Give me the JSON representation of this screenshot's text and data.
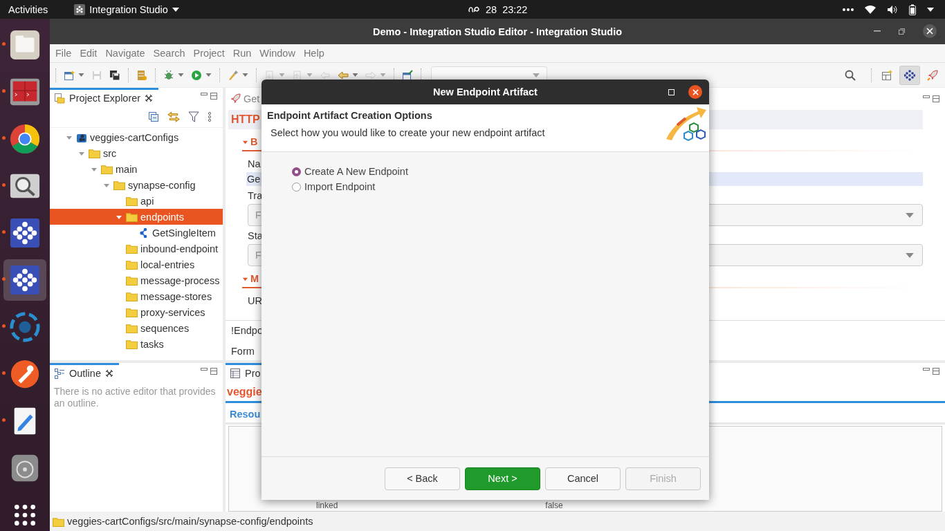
{
  "top_bar": {
    "activities": "Activities",
    "app_menu": "Integration Studio",
    "date": "28",
    "time": "23:22"
  },
  "dock": [
    {
      "kind": "files",
      "running": true,
      "active": false
    },
    {
      "kind": "terminal",
      "running": true,
      "active": false
    },
    {
      "kind": "browser",
      "running": true,
      "active": false
    },
    {
      "kind": "magnifier",
      "running": true,
      "active": false
    },
    {
      "kind": "integration",
      "running": true,
      "active": false
    },
    {
      "kind": "integration",
      "running": true,
      "active": true
    },
    {
      "kind": "swirl",
      "running": true,
      "active": false
    },
    {
      "kind": "pen-circle",
      "running": true,
      "active": false
    },
    {
      "kind": "text-editor",
      "running": true,
      "active": false
    },
    {
      "kind": "disc",
      "running": false,
      "active": false
    },
    {
      "kind": "app-grid",
      "running": false,
      "active": false
    }
  ],
  "window": {
    "title": "Demo - Integration Studio Editor - Integration Studio"
  },
  "menu": [
    "File",
    "Edit",
    "Navigate",
    "Search",
    "Project",
    "Run",
    "Window",
    "Help"
  ],
  "toolbar": {
    "groups": [
      [
        {
          "kind": "new",
          "caret": true,
          "disabled": false
        },
        {
          "kind": "save",
          "caret": false,
          "disabled": true
        },
        {
          "kind": "save-all",
          "caret": false,
          "disabled": false
        }
      ],
      [
        {
          "kind": "server",
          "caret": false,
          "disabled": false
        }
      ],
      [
        {
          "kind": "debug",
          "caret": true,
          "disabled": false
        },
        {
          "kind": "run",
          "caret": true,
          "disabled": false
        }
      ],
      [
        {
          "kind": "pen",
          "caret": true,
          "disabled": false
        }
      ],
      [
        {
          "kind": "next-annotation",
          "caret": true,
          "disabled": true
        },
        {
          "kind": "prev-annotation",
          "caret": true,
          "disabled": true
        },
        {
          "kind": "last-edit",
          "caret": false,
          "disabled": true
        },
        {
          "kind": "back",
          "caret": true,
          "disabled": false
        },
        {
          "kind": "forward",
          "caret": true,
          "disabled": true
        }
      ],
      [
        {
          "kind": "open-task",
          "caret": false,
          "disabled": false
        }
      ]
    ]
  },
  "perspectives": [
    {
      "kind": "open",
      "selected": false
    },
    {
      "kind": "integration",
      "selected": true
    },
    {
      "kind": "rocket",
      "selected": false
    }
  ],
  "project_explorer": {
    "title": "Project Explorer",
    "tree": [
      {
        "label": "veggies-cartConfigs",
        "kind": "project",
        "expanded": true,
        "selected": false,
        "children": [
          {
            "label": "src",
            "kind": "folder",
            "expanded": true,
            "selected": false,
            "children": [
              {
                "label": "main",
                "kind": "folder",
                "expanded": true,
                "selected": false,
                "children": [
                  {
                    "label": "synapse-config",
                    "kind": "folder",
                    "expanded": true,
                    "selected": false,
                    "children": [
                      {
                        "label": "api",
                        "kind": "folder",
                        "selected": false
                      },
                      {
                        "label": "endpoints",
                        "kind": "folder",
                        "expanded": true,
                        "selected": true,
                        "children": [
                          {
                            "label": "GetSingleItem",
                            "kind": "endpoint",
                            "selected": false
                          }
                        ]
                      },
                      {
                        "label": "inbound-endpoint",
                        "kind": "folder",
                        "selected": false
                      },
                      {
                        "label": "local-entries",
                        "kind": "folder",
                        "selected": false
                      },
                      {
                        "label": "message-process",
                        "kind": "folder",
                        "selected": false
                      },
                      {
                        "label": "message-stores",
                        "kind": "folder",
                        "selected": false
                      },
                      {
                        "label": "proxy-services",
                        "kind": "folder",
                        "selected": false
                      },
                      {
                        "label": "sequences",
                        "kind": "folder",
                        "selected": false
                      },
                      {
                        "label": "tasks",
                        "kind": "folder",
                        "selected": false
                      }
                    ]
                  }
                ]
              }
            ]
          }
        ]
      }
    ]
  },
  "outline": {
    "title": "Outline",
    "message": "There is no active editor that provides an outline."
  },
  "editor": {
    "tab": "Get",
    "form_title": "HTTP",
    "sections": [
      {
        "label": "B",
        "expanded": true,
        "fields": [
          {
            "kind": "text",
            "label": "Na",
            "value": "Ge"
          },
          {
            "kind": "select",
            "label": "Tra",
            "value": "F"
          },
          {
            "kind": "select",
            "label": "Sta",
            "value": "F"
          }
        ]
      },
      {
        "label": "M",
        "expanded": true,
        "fields": [
          {
            "kind": "none",
            "label": "UR"
          }
        ]
      }
    ],
    "bottom_tabs": [
      "!Endpo",
      "Form"
    ]
  },
  "properties": {
    "tab": "Pro",
    "title": "veggie",
    "tabs": [
      "Resou"
    ],
    "rows": [
      {
        "property": "linked",
        "value": "false"
      }
    ]
  },
  "dialog": {
    "title": "New Endpoint Artifact",
    "heading": "Endpoint Artifact Creation Options",
    "description": "Select how you would like to create your new endpoint artifact",
    "options": [
      {
        "label": "Create A New Endpoint",
        "selected": true
      },
      {
        "label": "Import Endpoint",
        "selected": false
      }
    ],
    "buttons": [
      {
        "label": "< Back",
        "kind": "default",
        "disabled": false
      },
      {
        "label": "Next >",
        "kind": "primary",
        "disabled": false
      },
      {
        "label": "Cancel",
        "kind": "default",
        "disabled": false
      },
      {
        "label": "Finish",
        "kind": "default",
        "disabled": true
      }
    ]
  },
  "status_bar": {
    "path": "veggies-cartConfigs/src/main/synapse-config/endpoints"
  }
}
